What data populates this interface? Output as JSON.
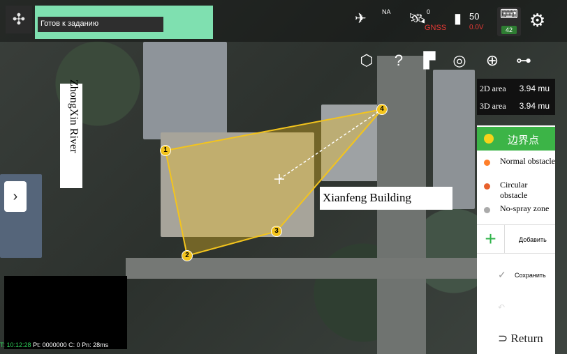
{
  "status": {
    "text": "Готов к заданию"
  },
  "top_icons": {
    "link_label": "NA",
    "gnss_count": "0",
    "gnss_label": "GNSS",
    "battery_percent": "50",
    "battery_voltage": "0.0V",
    "rc_battery": "42"
  },
  "area": {
    "area_2d_label": "2D area",
    "area_2d_value": "3.94 mu",
    "area_3d_label": "3D area",
    "area_3d_value": "3.94 mu"
  },
  "panel": {
    "mode_selected": "边界点",
    "options": [
      {
        "label": "Normal obstacle",
        "color": "#ff7f2a"
      },
      {
        "label": "Circular obstacle",
        "color": "#e8612c"
      },
      {
        "label": "No-spray zone",
        "color": "#aaaaaa"
      }
    ],
    "add_label": "Добавить",
    "save_label": "Сохранить",
    "return_label": "Return"
  },
  "map_labels": {
    "river": "ZhongXin River",
    "building": "Xianfeng Building"
  },
  "boundary_points": [
    {
      "id": "1"
    },
    {
      "id": "2"
    },
    {
      "id": "3"
    },
    {
      "id": "4"
    }
  ],
  "telemetry": {
    "time": "T: 10:12:28",
    "rest": "Pt: 0000000 C: 0 Pn: 28ms"
  },
  "colors": {
    "accent_green": "#3cb447",
    "boundary_yellow": "#f3c41d",
    "status_bg": "#7fe0b0"
  }
}
